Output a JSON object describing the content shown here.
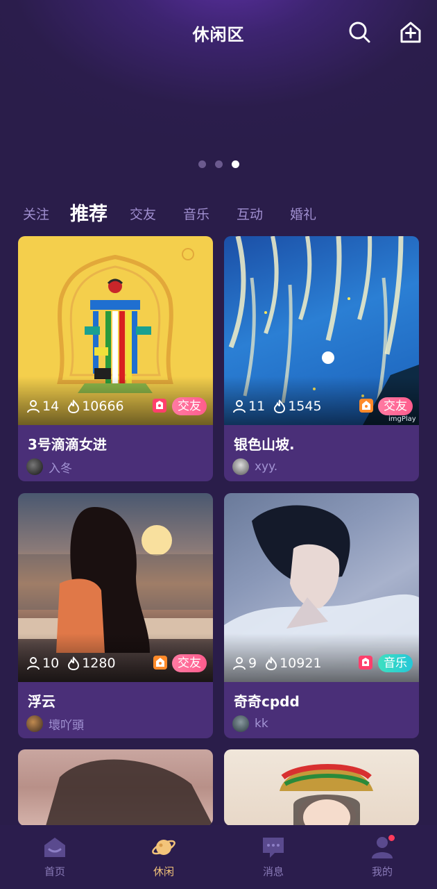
{
  "header": {
    "title": "休闲区"
  },
  "banner": {
    "dot_count": 3,
    "active_dot": 2
  },
  "tabs": [
    {
      "label": "关注",
      "active": false
    },
    {
      "label": "推荐",
      "active": true
    },
    {
      "label": "交友",
      "active": false
    },
    {
      "label": "音乐",
      "active": false
    },
    {
      "label": "互动",
      "active": false
    },
    {
      "label": "婚礼",
      "active": false
    }
  ],
  "rooms": [
    {
      "name": "3号滴滴女进",
      "owner": "入冬",
      "members": "14",
      "heat": "10666",
      "tag": "交友",
      "tag_color": "#ff5c8d",
      "badge_color": "#ff3f6c"
    },
    {
      "name": "银色山坡.",
      "owner": "xyy.",
      "members": "11",
      "heat": "1545",
      "tag": "交友",
      "tag_color": "#ff5c8d",
      "badge_color": "#ff8a2a",
      "watermark": "imgPlay"
    },
    {
      "name": "浮云",
      "owner": "壞吖頭",
      "members": "10",
      "heat": "1280",
      "tag": "交友",
      "tag_color": "#ff5c8d",
      "badge_color": "#ff8a2a"
    },
    {
      "name": "奇奇cpdd",
      "owner": "kk",
      "members": "9",
      "heat": "10921",
      "tag": "音乐",
      "tag_color": "#25c7d8",
      "badge_color": "#ff3f6c"
    }
  ],
  "bottom_nav": [
    {
      "label": "首页",
      "icon": "home-icon",
      "active": false
    },
    {
      "label": "休闲",
      "icon": "planet-icon",
      "active": true
    },
    {
      "label": "消息",
      "icon": "message-icon",
      "active": false
    },
    {
      "label": "我的",
      "icon": "profile-icon",
      "active": false,
      "badge": true
    }
  ],
  "colors": {
    "background": "#2a1d4a",
    "card": "#4a2f78",
    "active_nav": "#f3c47a",
    "tab_inactive": "#a08fd0"
  }
}
